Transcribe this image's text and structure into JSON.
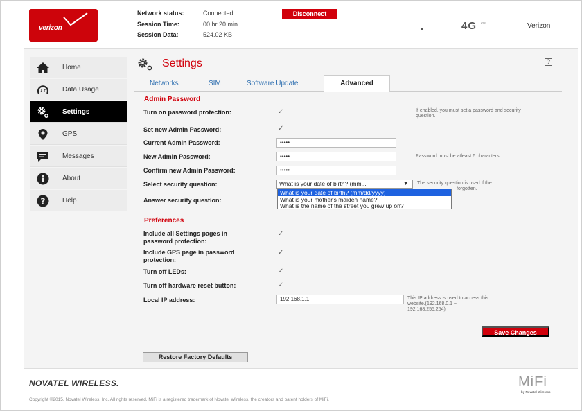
{
  "brand": {
    "logo_text": "verizon",
    "accent_color": "#cd040b"
  },
  "header": {
    "network_status_label": "Network status:",
    "network_status_value": "Connected",
    "session_time_label": "Session Time:",
    "session_time_value": "00 hr 20 min",
    "session_data_label": "Session Data:",
    "session_data_value": "524.02 KB",
    "disconnect_label": "Disconnect",
    "network_type": "4G",
    "network_type_sub": "LTE",
    "carrier": "Verizon"
  },
  "sidebar": {
    "items": [
      {
        "label": "Home",
        "icon": "home-icon"
      },
      {
        "label": "Data Usage",
        "icon": "data-usage-icon"
      },
      {
        "label": "Settings",
        "icon": "gear-icon",
        "active": true
      },
      {
        "label": "GPS",
        "icon": "location-pin-icon"
      },
      {
        "label": "Messages",
        "icon": "message-icon"
      },
      {
        "label": "About",
        "icon": "info-icon"
      },
      {
        "label": "Help",
        "icon": "question-icon"
      }
    ]
  },
  "main": {
    "title": "Settings",
    "help_icon_text": "?",
    "tabs": [
      {
        "label": "Networks"
      },
      {
        "label": "SIM"
      },
      {
        "label": "Software Update"
      },
      {
        "label": "Advanced",
        "active": true
      }
    ],
    "admin_password": {
      "section_title": "Admin Password",
      "turn_on_protection_label": "Turn on password protection:",
      "turn_on_protection_checked": true,
      "turn_on_protection_note": "If enabled, you must set a password and security question.",
      "set_new_password_label": "Set new Admin Password:",
      "set_new_password_checked": true,
      "current_password_label": "Current Admin Password:",
      "current_password_value": "•••••",
      "new_password_label": "New Admin Password:",
      "new_password_value": "•••••",
      "new_password_note": "Password must be atleast 6 characters",
      "confirm_password_label": "Confirm new Admin Password:",
      "confirm_password_value": "•••••",
      "security_question_label": "Select security question:",
      "security_question_selected": "What is your date of birth? (mm...",
      "security_question_note_line1": "The security question is used if the",
      "security_question_note_line2": "forgotten.",
      "security_question_options": [
        "What is your date of birth? (mm/dd/yyyy)",
        "What is your mother's maiden name?",
        "What is the name of the street you grew up on?"
      ],
      "answer_label": "Answer security question:"
    },
    "preferences": {
      "section_title": "Preferences",
      "include_settings_label_1": "Include all Settings pages in",
      "include_settings_label_2": "password protection:",
      "include_settings_checked": true,
      "include_gps_label_1": "Include GPS page in password",
      "include_gps_label_2": "protection:",
      "include_gps_checked": true,
      "turn_off_leds_label": "Turn off LEDs:",
      "turn_off_leds_checked": true,
      "turn_off_reset_label": "Turn off hardware reset button:",
      "turn_off_reset_checked": true,
      "local_ip_label": "Local IP address:",
      "local_ip_value": "192.168.1.1",
      "local_ip_note_1": "This IP address is used to access this",
      "local_ip_note_2": "website.(192.168.0.1 ~",
      "local_ip_note_3": "192.168.255.254)"
    },
    "save_label": "Save Changes",
    "restore_label": "Restore Factory Defaults"
  },
  "footer": {
    "company_logo": "NOVATEL WIRELESS.",
    "product_logo": "MiFi",
    "product_logo_sub": "by Novatel Wireless",
    "copyright": "Copyright ©2015. Novatel Wireless, Inc. All rights reserved. MiFi is a registered trademark of Novatel Wireless, the creators and patent holders of MiFi."
  }
}
